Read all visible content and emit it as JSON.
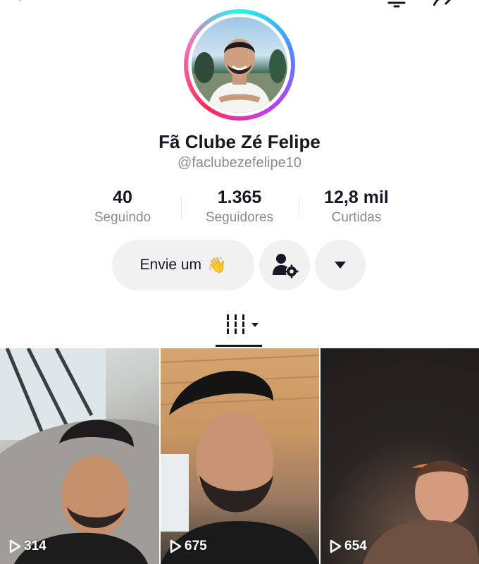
{
  "header": {
    "back_icon": "chevron-left-icon",
    "right_icons": [
      "bell-icon",
      "share-icon"
    ]
  },
  "profile": {
    "display_name": "Fã Clube Zé Felipe",
    "username": "@faclubezefelipe10",
    "ring_colors": [
      "#25f4ee",
      "#fe2c55"
    ]
  },
  "stats": [
    {
      "value": "40",
      "label": "Seguindo"
    },
    {
      "value": "1.365",
      "label": "Seguidores"
    },
    {
      "value": "12,8 mil",
      "label": "Curtidas"
    }
  ],
  "actions": {
    "message_label": "Envie um",
    "message_emoji": "👋",
    "friend_icon": "add-friend-settings-icon",
    "more_icon": "caret-down-icon"
  },
  "tabs": {
    "active_icon": "videos-grid-icon"
  },
  "videos": [
    {
      "views": "314"
    },
    {
      "views": "675"
    },
    {
      "views": "654"
    }
  ]
}
